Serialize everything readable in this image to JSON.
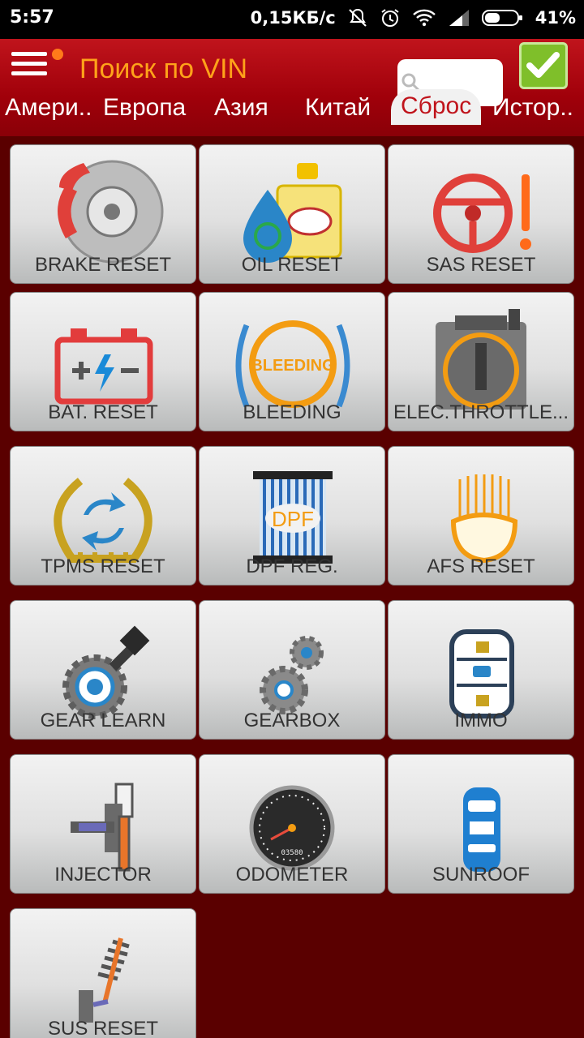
{
  "status_bar": {
    "time": "5:57",
    "net_speed": "0,15КБ/с",
    "battery": "41%"
  },
  "header": {
    "title": "Поиск по VIN",
    "search_icon": "search-icon",
    "confirm_icon": "checkmark-icon"
  },
  "tabs": [
    {
      "label": "Амери.."
    },
    {
      "label": "Европа"
    },
    {
      "label": "Азия"
    },
    {
      "label": "Китай"
    },
    {
      "label": "Сброс"
    },
    {
      "label": "Истор.."
    }
  ],
  "active_tab": "Сброс",
  "tiles": [
    {
      "label": "BRAKE RESET",
      "icon": "brake-disc-icon"
    },
    {
      "label": "OIL RESET",
      "icon": "oil-bottle-icon"
    },
    {
      "label": "SAS RESET",
      "icon": "steering-wheel-icon"
    },
    {
      "label": "BAT. RESET",
      "icon": "battery-icon"
    },
    {
      "label": "BLEEDING",
      "icon": "bleeding-icon"
    },
    {
      "label": "ELEC.THROTTLE...",
      "icon": "throttle-icon"
    },
    {
      "label": "TPMS RESET",
      "icon": "tire-pressure-icon"
    },
    {
      "label": "DPF REG.",
      "icon": "dpf-filter-icon"
    },
    {
      "label": "AFS RESET",
      "icon": "headlight-icon"
    },
    {
      "label": "GEAR LEARN",
      "icon": "gear-learn-icon"
    },
    {
      "label": "GEARBOX",
      "icon": "gearbox-icon"
    },
    {
      "label": "IMMO",
      "icon": "immobilizer-key-icon"
    },
    {
      "label": "INJECTOR",
      "icon": "injector-icon"
    },
    {
      "label": "ODOMETER",
      "icon": "odometer-icon"
    },
    {
      "label": "SUNROOF",
      "icon": "sunroof-car-icon"
    },
    {
      "label": "SUS RESET",
      "icon": "suspension-icon"
    }
  ],
  "icon_text": {
    "bleeding_badge": "BLEEDING",
    "dpf_badge": "DPF",
    "odometer_counter": "03580"
  },
  "colors": {
    "header_red": "#a0000a",
    "title_orange": "#ffa21a",
    "background": "#5a0000",
    "confirm_green": "#7fbf2a"
  }
}
